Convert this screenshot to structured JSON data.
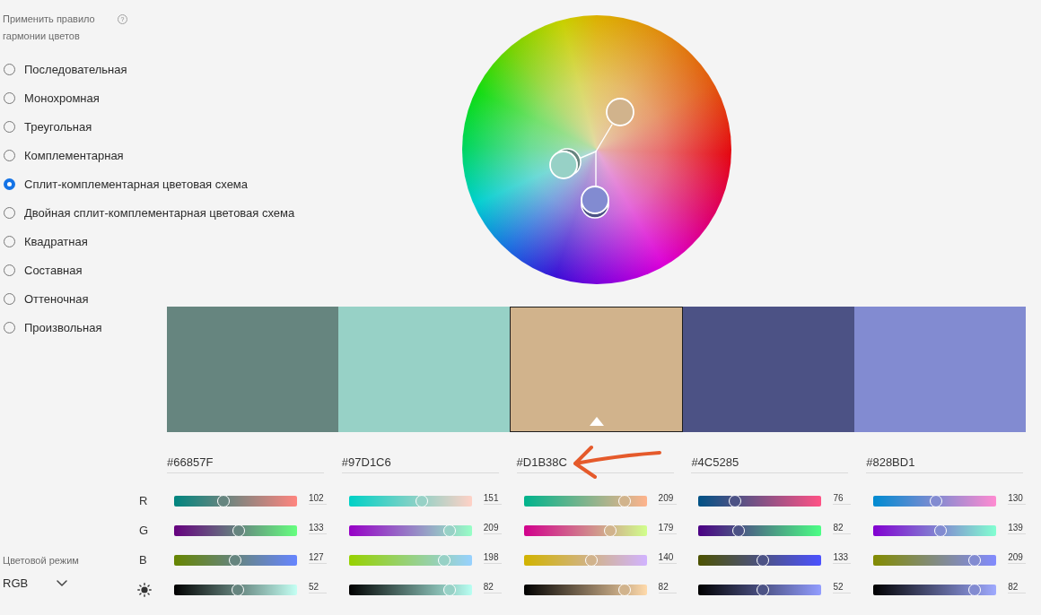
{
  "harmony": {
    "title": "Применить правило гармонии цветов",
    "help": "?",
    "options": [
      {
        "label": "Последовательная",
        "selected": false
      },
      {
        "label": "Монохромная",
        "selected": false
      },
      {
        "label": "Треугольная",
        "selected": false
      },
      {
        "label": "Комплементарная",
        "selected": false
      },
      {
        "label": "Сплит-комплементарная цветовая схема",
        "selected": true
      },
      {
        "label": "Двойная сплит-комплементарная цветовая схема",
        "selected": false
      },
      {
        "label": "Квадратная",
        "selected": false
      },
      {
        "label": "Составная",
        "selected": false
      },
      {
        "label": "Оттеночная",
        "selected": false
      },
      {
        "label": "Произвольная",
        "selected": false
      }
    ]
  },
  "palette": [
    {
      "color": "#66857f",
      "hex": "#66857F",
      "selected": false,
      "annotated": false,
      "channels": [
        {
          "value": "102",
          "level": 0.4
        },
        {
          "value": "133",
          "level": 0.522
        },
        {
          "value": "127",
          "level": 0.498
        },
        {
          "value": "52",
          "level": 0.52
        }
      ]
    },
    {
      "color": "#97d1c6",
      "hex": "#97D1C6",
      "selected": false,
      "annotated": false,
      "channels": [
        {
          "value": "151",
          "level": 0.592
        },
        {
          "value": "209",
          "level": 0.82
        },
        {
          "value": "198",
          "level": 0.776
        },
        {
          "value": "82",
          "level": 0.82
        }
      ]
    },
    {
      "color": "#d1b38c",
      "hex": "#D1B38C",
      "selected": true,
      "annotated": true,
      "channels": [
        {
          "value": "209",
          "level": 0.82
        },
        {
          "value": "179",
          "level": 0.702
        },
        {
          "value": "140",
          "level": 0.549
        },
        {
          "value": "82",
          "level": 0.82
        }
      ]
    },
    {
      "color": "#4c5285",
      "hex": "#4C5285",
      "selected": false,
      "annotated": false,
      "channels": [
        {
          "value": "76",
          "level": 0.298
        },
        {
          "value": "82",
          "level": 0.322
        },
        {
          "value": "133",
          "level": 0.522
        },
        {
          "value": "52",
          "level": 0.52
        }
      ]
    },
    {
      "color": "#828bd1",
      "hex": "#828BD1",
      "selected": false,
      "annotated": false,
      "channels": [
        {
          "value": "130",
          "level": 0.51
        },
        {
          "value": "139",
          "level": 0.545
        },
        {
          "value": "209",
          "level": 0.82
        },
        {
          "value": "82",
          "level": 0.82
        }
      ]
    }
  ],
  "channel_labels": [
    {
      "kind": "letter",
      "label": "R"
    },
    {
      "kind": "letter",
      "label": "G"
    },
    {
      "kind": "letter",
      "label": "B"
    },
    {
      "kind": "brightness"
    }
  ],
  "color_mode": {
    "label": "Цветовой режим",
    "value": "RGB"
  }
}
